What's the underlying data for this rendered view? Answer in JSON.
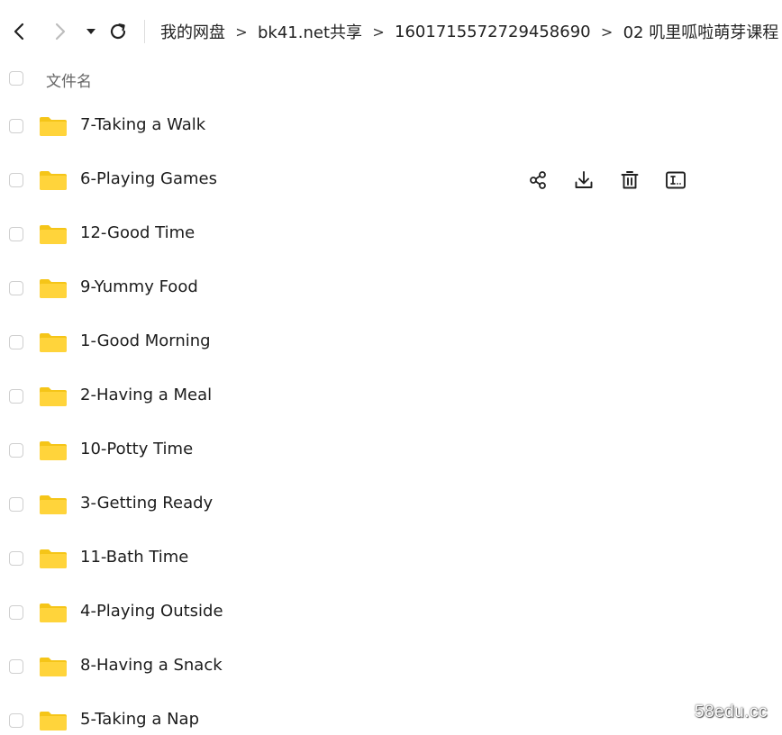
{
  "toolbar": {
    "back_icon": "chevron-left-icon",
    "forward_icon": "chevron-right-icon",
    "history_icon": "caret-down-icon",
    "refresh_icon": "refresh-icon"
  },
  "breadcrumb": {
    "items": [
      "我的网盘",
      "bk41.net共享",
      "1601715572729458690",
      "02 叽里呱啦萌芽课程"
    ],
    "separator": ">"
  },
  "list_header": {
    "name_column": "文件名"
  },
  "files": [
    {
      "name": "7-Taking a Walk",
      "type": "folder"
    },
    {
      "name": "6-Playing Games",
      "type": "folder",
      "hovered": true
    },
    {
      "name": "12-Good Time",
      "type": "folder"
    },
    {
      "name": "9-Yummy Food",
      "type": "folder"
    },
    {
      "name": "1-Good Morning",
      "type": "folder"
    },
    {
      "name": "2-Having a Meal",
      "type": "folder"
    },
    {
      "name": "10-Potty Time",
      "type": "folder"
    },
    {
      "name": "3-Getting Ready",
      "type": "folder"
    },
    {
      "name": "11-Bath Time",
      "type": "folder"
    },
    {
      "name": "4-Playing Outside",
      "type": "folder"
    },
    {
      "name": "8-Having a Snack",
      "type": "folder"
    },
    {
      "name": "5-Taking a Nap",
      "type": "folder"
    }
  ],
  "row_actions": [
    "share-icon",
    "download-icon",
    "delete-icon",
    "rename-icon"
  ],
  "watermark": "58edu.cc",
  "colors": {
    "folder": "#FFD43B",
    "folder_tab": "#F5C518",
    "checkbox_border": "#cfcfcf",
    "text": "#1c1c1c",
    "header_text": "#666666"
  }
}
